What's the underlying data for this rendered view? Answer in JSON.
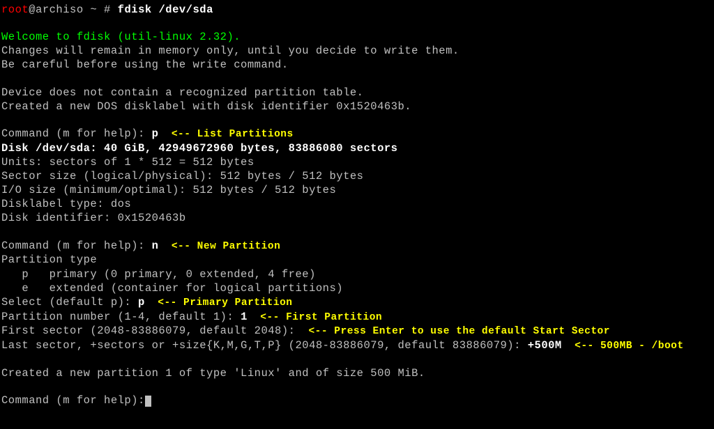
{
  "prompt": {
    "user": "root",
    "at": "@",
    "host": "archiso",
    "path": " ~ # ",
    "cmd": "fdisk /dev/sda"
  },
  "welcome": "Welcome to fdisk (util-linux 2.32).",
  "warn1": "Changes will remain in memory only, until you decide to write them.",
  "warn2": "Be careful before using the write command.",
  "dev1": "Device does not contain a recognized partition table.",
  "dev2": "Created a new DOS disklabel with disk identifier 0x1520463b.",
  "cmd1": {
    "label": "Command (m for help): ",
    "input": "p",
    "note": "  <-- List Partitions"
  },
  "disk": "Disk /dev/sda: 40 GiB, 42949672960 bytes, 83886080 sectors",
  "units": "Units: sectors of 1 * 512 = 512 bytes",
  "sector": "Sector size (logical/physical): 512 bytes / 512 bytes",
  "iosize": "I/O size (minimum/optimal): 512 bytes / 512 bytes",
  "dltype": "Disklabel type: dos",
  "diskid": "Disk identifier: 0x1520463b",
  "cmd2": {
    "label": "Command (m for help): ",
    "input": "n",
    "note": "  <-- New Partition"
  },
  "ptype": "Partition type",
  "pprimary": "   p   primary (0 primary, 0 extended, 4 free)",
  "pextended": "   e   extended (container for logical partitions)",
  "select": {
    "label": "Select (default p): ",
    "input": "p",
    "note": "  <-- Primary Partition"
  },
  "pnum": {
    "label": "Partition number (1-4, default 1): ",
    "input": "1",
    "note": "  <-- First Partition"
  },
  "fsector": {
    "label": "First sector (2048-83886079, default 2048): ",
    "note": " <-- Press Enter to use the default Start Sector"
  },
  "lsector": {
    "label": "Last sector, +sectors or +size{K,M,G,T,P} (2048-83886079, default 83886079): ",
    "input": "+500M",
    "note": "  <-- 500MB - /boot"
  },
  "created": "Created a new partition 1 of type 'Linux' and of size 500 MiB.",
  "cmd3": "Command (m for help):"
}
